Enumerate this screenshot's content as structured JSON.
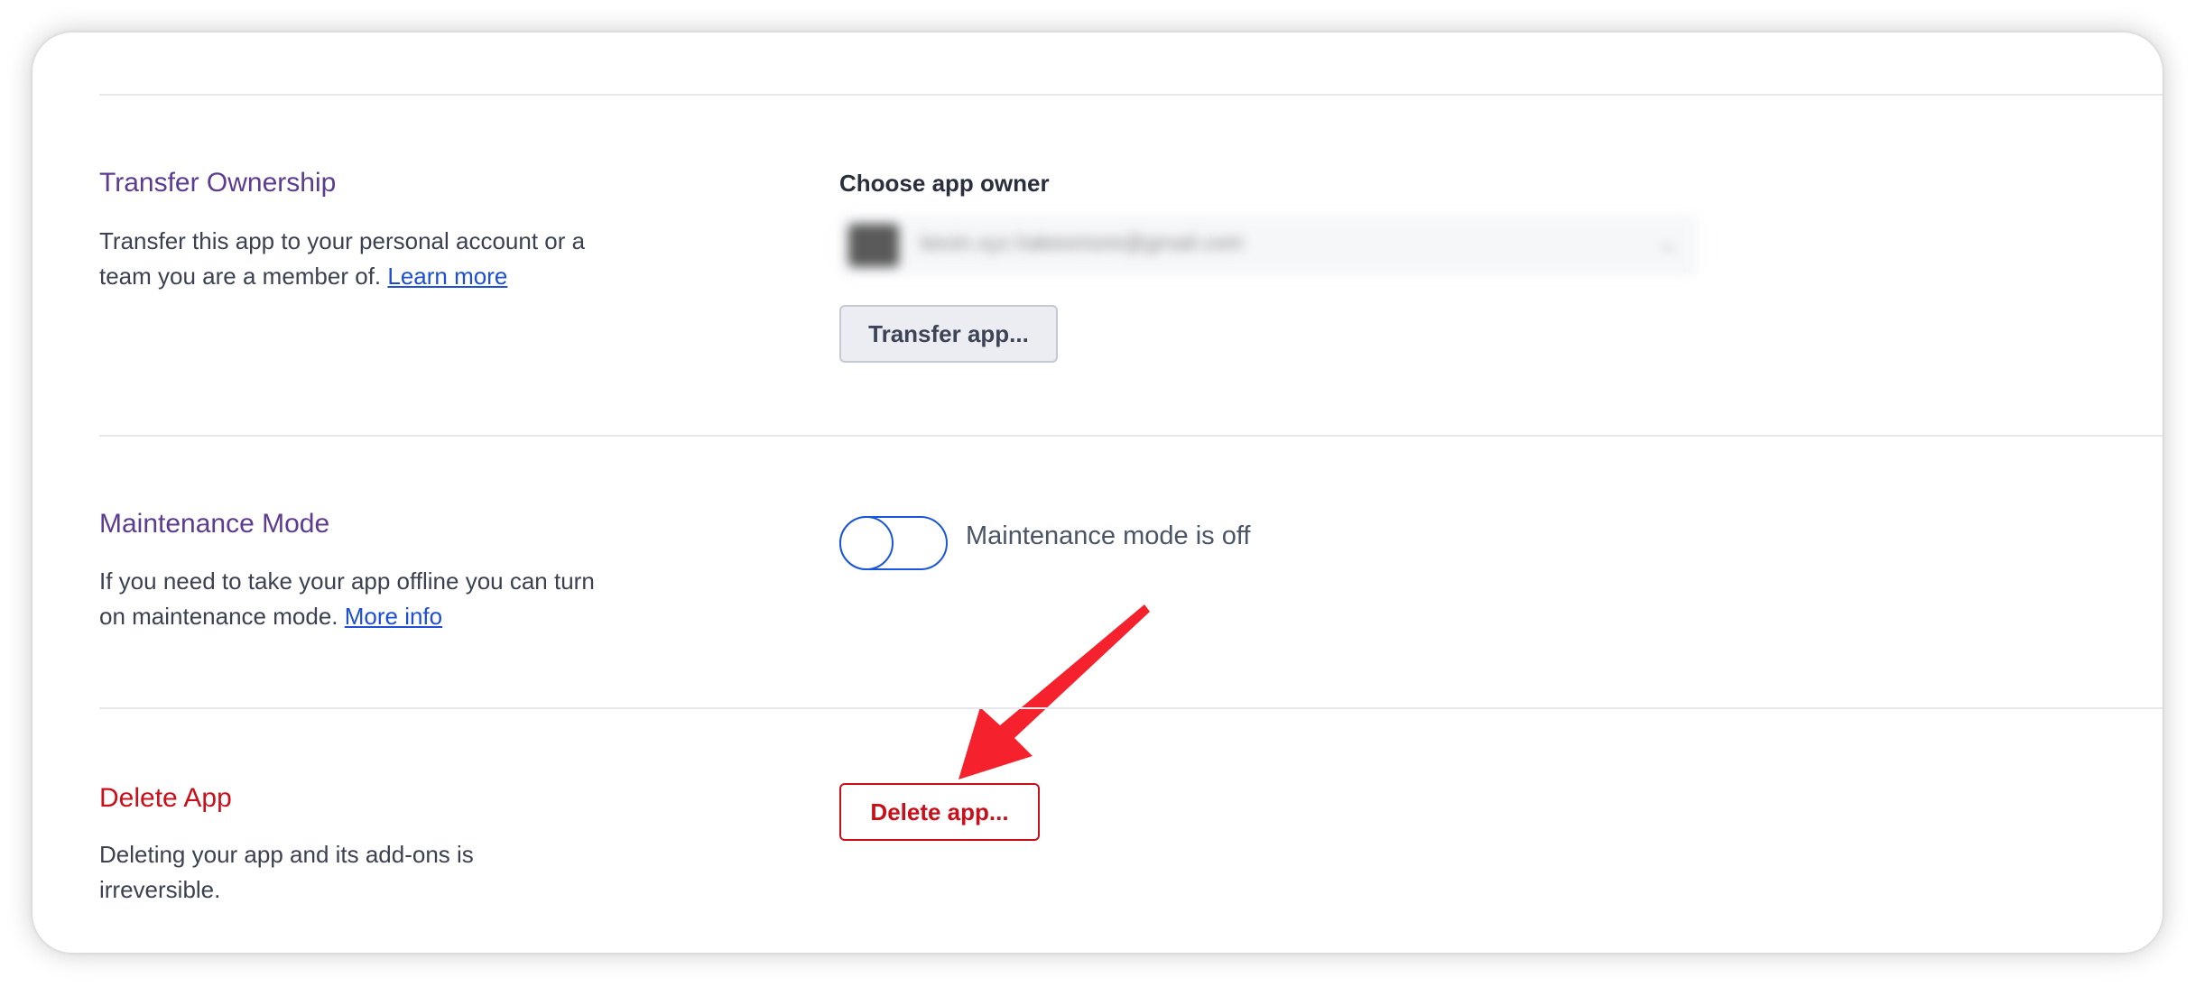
{
  "transfer": {
    "title": "Transfer Ownership",
    "description": "Transfer this app to your personal account or a team you are a member of. ",
    "link_label": "Learn more",
    "field_label": "Choose app owner",
    "owner_value": "kevin.xyz.hakesmore@gmail.com",
    "button_label": "Transfer app..."
  },
  "maintenance": {
    "title": "Maintenance Mode",
    "description": "If you need to take your app offline you can turn on maintenance mode. ",
    "link_label": "More info",
    "status_label": "Maintenance mode is off",
    "enabled": false
  },
  "delete": {
    "title": "Delete App",
    "description": "Deleting your app and its add-ons is irreversible.",
    "button_label": "Delete app..."
  },
  "colors": {
    "section_title": "#5c3b91",
    "danger": "#c9101a",
    "link": "#1d4ed8",
    "toggle": "#1a56db",
    "annotation_arrow": "#f5222d"
  }
}
